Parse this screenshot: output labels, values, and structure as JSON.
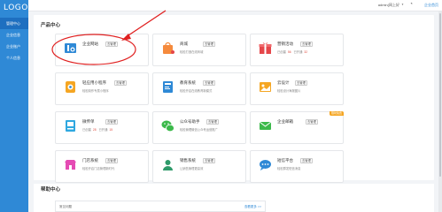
{
  "logo": "LOGO",
  "sidebar": {
    "items": [
      {
        "label": "管理中心",
        "active": true
      },
      {
        "label": "企业信息",
        "active": false
      },
      {
        "label": "企业账户",
        "active": false
      },
      {
        "label": "个人信息",
        "active": false
      }
    ]
  },
  "topbar": {
    "user": "admin(网上好",
    "link": "企业首页"
  },
  "products": {
    "title": "产品中心",
    "cards": [
      {
        "name": "企业网站",
        "status": "去管理",
        "desc": "",
        "icon": "website-icon",
        "color": "#2f89d6"
      },
      {
        "name": "商城",
        "status": "去管理",
        "desc": "轻松打造在线商城",
        "icon": "shopping-bag-icon",
        "color": "#f58a3c"
      },
      {
        "name": "营销活动",
        "status": "去管理",
        "stats_label": "已创建",
        "stats_value": "56",
        "stats_label2": "已开通",
        "stats_value2": "32",
        "icon": "gift-icon",
        "color": "#e5464a"
      },
      {
        "name": "轻应用小程序",
        "status": "去管理",
        "desc": "轻松制作专属小程序",
        "icon": "mini-program-icon",
        "color": "#f5a623"
      },
      {
        "name": "教育系统",
        "status": "去管理",
        "desc": "轻松开启在线教育新模式",
        "icon": "book-icon",
        "color": "#2f89d6"
      },
      {
        "name": "云设计",
        "status": "去管理",
        "desc": "轻松设计海报图片",
        "icon": "image-icon",
        "color": "#f5a623"
      },
      {
        "name": "微传单",
        "status": "去管理",
        "stats_label": "已创建",
        "stats_value": "28",
        "stats_label2": "已开通",
        "stats_value2": "15",
        "icon": "flyer-icon",
        "color": "#2fa8e0"
      },
      {
        "name": "公众号助手",
        "status": "去管理",
        "desc": "轻松管理微信公众号运营推广",
        "icon": "wechat-icon",
        "color": "#3cb94b"
      },
      {
        "name": "企业邮箱",
        "status": "去管理",
        "desc": "",
        "badge": "限时免费",
        "icon": "mail-icon",
        "color": "#3cb94b"
      },
      {
        "name": "门店系统",
        "status": "去管理",
        "desc": "轻松开启门店管理新时代",
        "icon": "store-icon",
        "color": "#e54bb4"
      },
      {
        "name": "销售系统",
        "status": "去管理",
        "desc": "让销售管理更高效",
        "icon": "sales-icon",
        "color": "#2f9a6a"
      },
      {
        "name": "短信平台",
        "status": "去管理",
        "desc": "轻松群发短信消息",
        "icon": "sms-icon",
        "color": "#2f89d6"
      }
    ]
  },
  "help": {
    "title": "帮助中心",
    "item": "常见问题",
    "more": "查看更多 >>"
  }
}
